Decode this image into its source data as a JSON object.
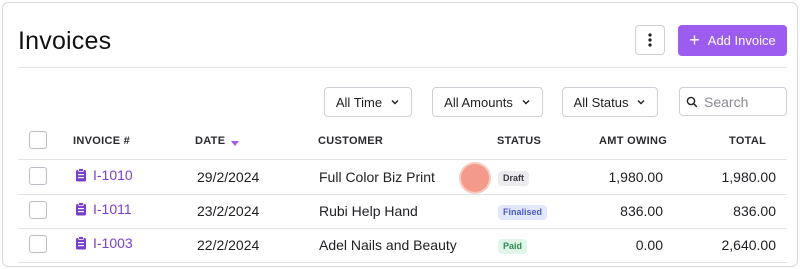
{
  "header": {
    "title": "Invoices",
    "more_icon": "more-vertical-icon",
    "add_button_label": "Add Invoice",
    "add_icon": "plus-icon",
    "accent_color": "#9d5cf0"
  },
  "filters": {
    "time": "All Time",
    "amounts": "All Amounts",
    "status": "All Status",
    "search_placeholder": "Search"
  },
  "table": {
    "columns": {
      "invoice": "INVOICE #",
      "date": "DATE",
      "customer": "CUSTOMER",
      "status": "STATUS",
      "amt_owing": "AMT OWING",
      "total": "TOTAL"
    },
    "sort_column": "DATE",
    "rows": [
      {
        "invoice": "I-1010",
        "date": "29/2/2024",
        "customer": "Full Color Biz Print",
        "status": "Draft",
        "amt_owing": "1,980.00",
        "total": "1,980.00"
      },
      {
        "invoice": "I-1011",
        "date": "23/2/2024",
        "customer": "Rubi Help Hand",
        "status": "Finalised",
        "amt_owing": "836.00",
        "total": "836.00"
      },
      {
        "invoice": "I-1003",
        "date": "22/2/2024",
        "customer": "Adel Nails and Beauty",
        "status": "Paid",
        "amt_owing": "0.00",
        "total": "2,640.00"
      }
    ]
  }
}
